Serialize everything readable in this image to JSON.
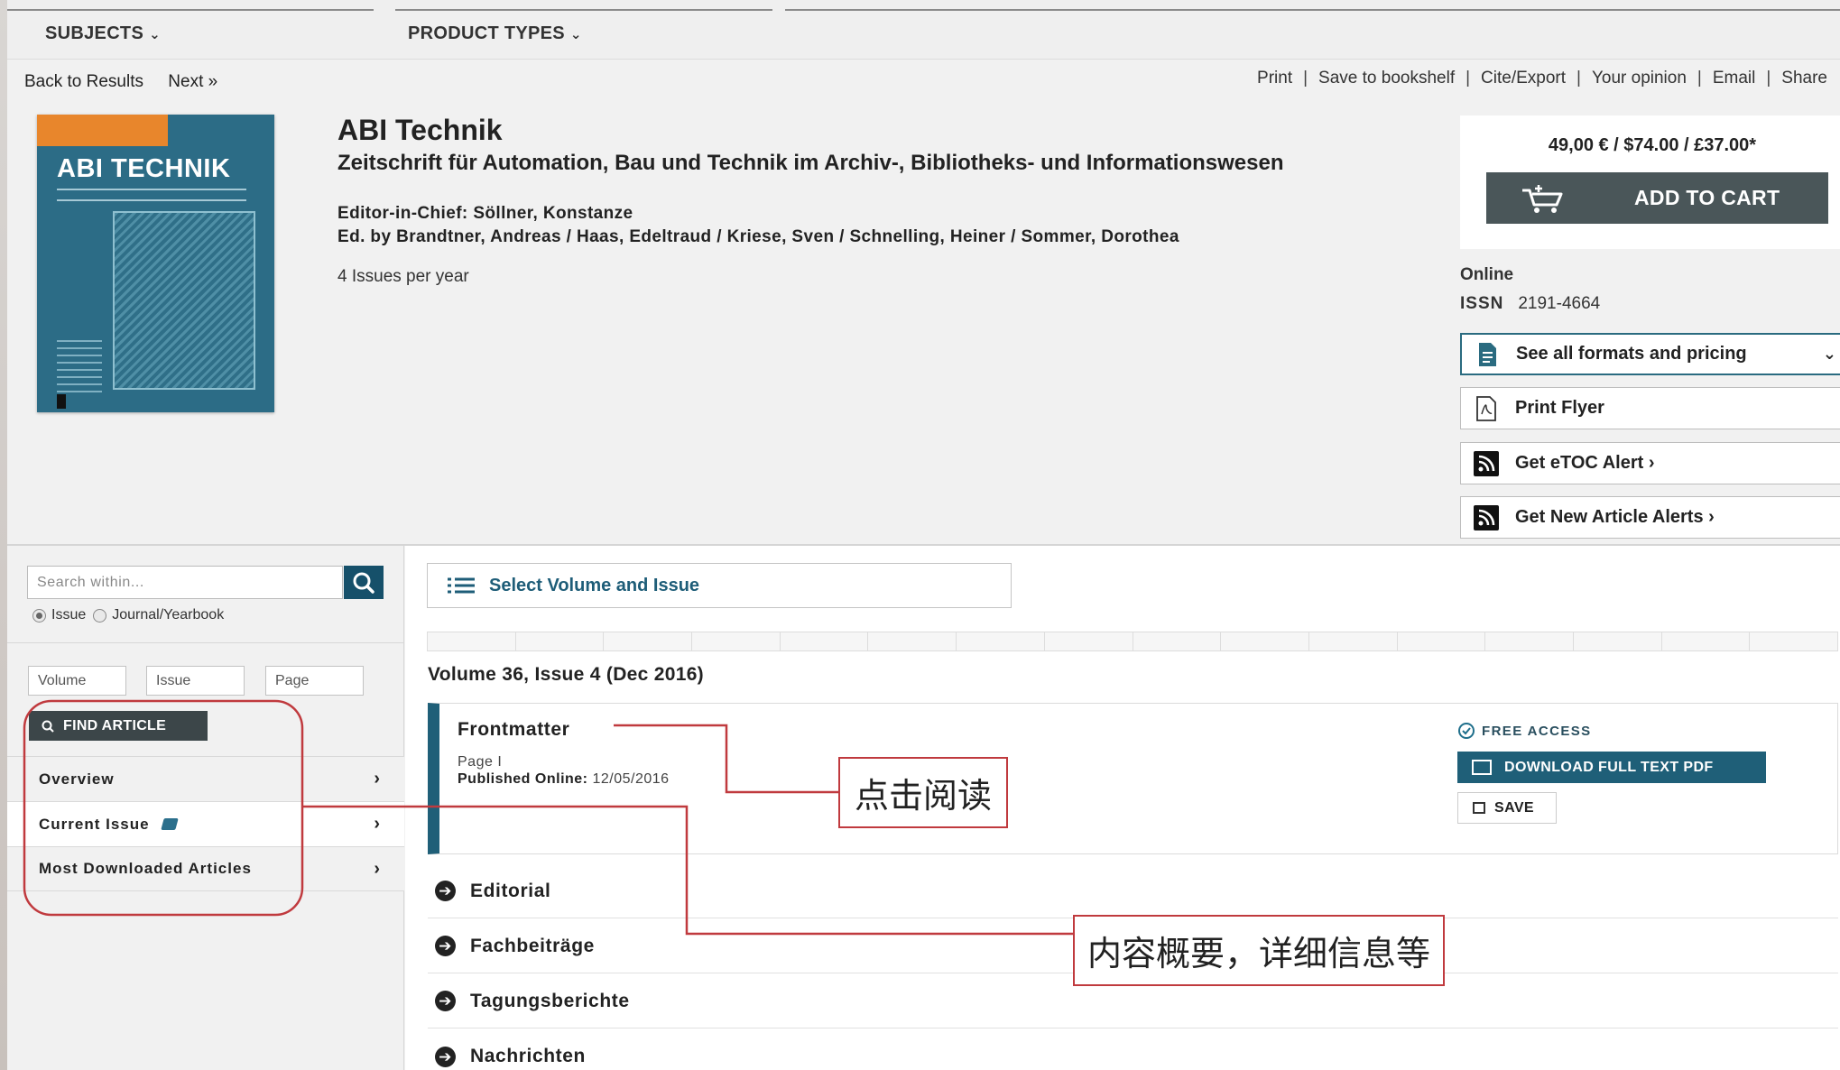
{
  "topnav": {
    "subjects": "SUBJECTS",
    "product_types": "PRODUCT TYPES"
  },
  "backnav": {
    "back": "Back to Results",
    "next": "Next »"
  },
  "actions": [
    "Print",
    "Save to bookshelf",
    "Cite/Export",
    "Your opinion",
    "Email",
    "Share"
  ],
  "cover": {
    "title": "ABI TECHNIK"
  },
  "journal": {
    "title": "ABI Technik",
    "subtitle": "Zeitschrift für Automation, Bau und Technik im Archiv-, Bibliotheks- und Informationswesen",
    "editor_in_chief": "Editor-in-Chief: Söllner, Konstanze",
    "edited_by": "Ed. by Brandtner, Andreas / Haas, Edeltraud / Kriese, Sven / Schnelling, Heiner / Sommer, Dorothea",
    "issues_per_year": "4 Issues per year"
  },
  "purchase": {
    "price": "49,00 € / $74.00 / £37.00*",
    "add_to_cart": "ADD TO CART",
    "format": "Online",
    "issn_label": "ISSN",
    "issn_value": "2191-4664",
    "see_formats": "See all formats and pricing",
    "print_flyer": "Print Flyer",
    "etoc_alert": "Get eTOC Alert ›",
    "new_article_alerts": "Get New Article Alerts ›"
  },
  "sidebar": {
    "search_placeholder": "Search within...",
    "radio_issue": "Issue",
    "radio_journal": "Journal/Yearbook",
    "volume_placeholder": "Volume",
    "issue_placeholder": "Issue",
    "page_placeholder": "Page",
    "find_article": "FIND ARTICLE",
    "items": [
      {
        "label": "Overview"
      },
      {
        "label": "Current Issue"
      },
      {
        "label": "Most Downloaded Articles"
      }
    ]
  },
  "main": {
    "select_volume": "Select Volume and Issue",
    "volume_title": "Volume 36, Issue 4 (Dec 2016)",
    "article": {
      "title": "Frontmatter",
      "page": "Page I",
      "published_label": "Published Online:",
      "published_date": "12/05/2016",
      "access": "FREE ACCESS",
      "download_pdf": "DOWNLOAD FULL TEXT PDF",
      "save": "SAVE"
    },
    "sections": [
      "Editorial",
      "Fachbeiträge",
      "Tagungsberichte",
      "Nachrichten"
    ]
  },
  "annotations": {
    "click_to_read": "点击阅读",
    "content_summary": "内容概要，详细信息等",
    "color": "#c03a3e"
  }
}
